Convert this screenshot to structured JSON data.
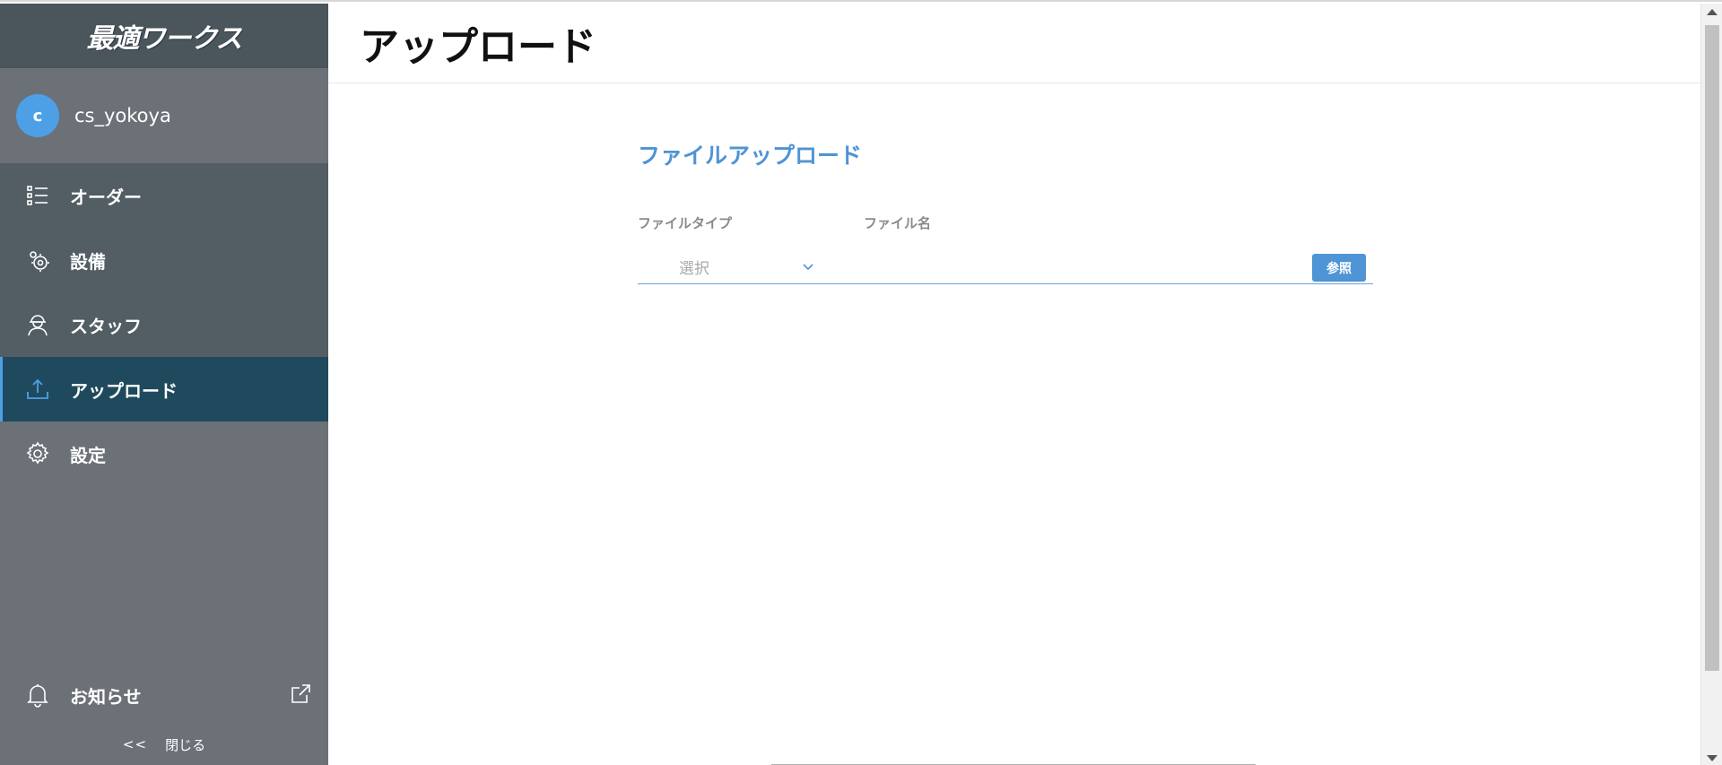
{
  "sidebar": {
    "logo_text": "最適ワークス",
    "user": {
      "avatar_letter": "c",
      "name": "cs_yokoya"
    },
    "items": [
      {
        "label": "オーダー",
        "icon": "list-icon"
      },
      {
        "label": "設備",
        "icon": "gear-cog-icon"
      },
      {
        "label": "スタッフ",
        "icon": "worker-icon"
      },
      {
        "label": "アップロード",
        "icon": "upload-icon",
        "active": true
      },
      {
        "label": "設定",
        "icon": "settings-icon"
      }
    ],
    "notice": {
      "label": "お知らせ",
      "icon": "bell-icon",
      "ext_icon": "external-link-icon"
    },
    "close": {
      "chevron": "<<",
      "label": "閉じる"
    }
  },
  "main": {
    "title": "アップロード",
    "section_title": "ファイルアップロード",
    "labels": {
      "file_type": "ファイルタイプ",
      "file_name": "ファイル名"
    },
    "select": {
      "value": "選択"
    },
    "filename": {
      "value": ""
    },
    "browse_button": "参照"
  },
  "colors": {
    "sidebar_bg": "#6c7177",
    "sidebar_dark": "#525d64",
    "active_bg": "#1f4a5e",
    "accent": "#4f94d4"
  }
}
